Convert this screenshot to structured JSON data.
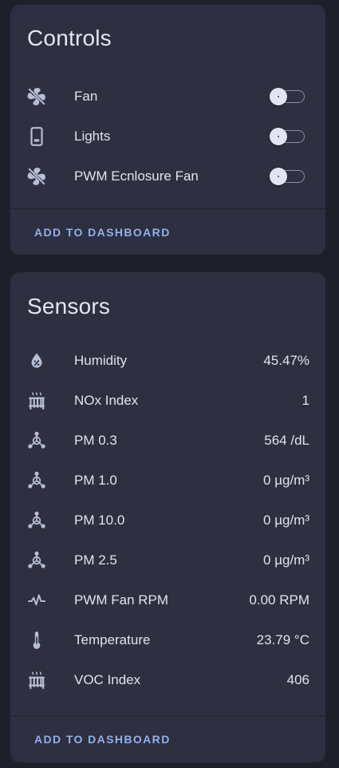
{
  "controls": {
    "title": "Controls",
    "items": [
      {
        "icon": "fan-off-icon",
        "label": "Fan",
        "state": "off"
      },
      {
        "icon": "phone-lights-icon",
        "label": "Lights",
        "state": "off"
      },
      {
        "icon": "fan-off-icon",
        "label": "PWM Ecnlosure Fan",
        "state": "off"
      }
    ],
    "action_label": "ADD TO DASHBOARD"
  },
  "sensors": {
    "title": "Sensors",
    "items": [
      {
        "icon": "water-percent-icon",
        "label": "Humidity",
        "value": "45.47%"
      },
      {
        "icon": "radiator-icon",
        "label": "NOx Index",
        "value": "1"
      },
      {
        "icon": "molecule-icon",
        "label": "PM 0.3",
        "value": "564 /dL"
      },
      {
        "icon": "molecule-icon",
        "label": "PM 1.0",
        "value": "0 µg/m³"
      },
      {
        "icon": "molecule-icon",
        "label": "PM 10.0",
        "value": "0 µg/m³"
      },
      {
        "icon": "molecule-icon",
        "label": "PM 2.5",
        "value": "0 µg/m³"
      },
      {
        "icon": "pulse-icon",
        "label": "PWM Fan RPM",
        "value": "0.00 RPM"
      },
      {
        "icon": "thermometer-icon",
        "label": "Temperature",
        "value": "23.79 °C"
      },
      {
        "icon": "radiator-icon",
        "label": "VOC Index",
        "value": "406"
      }
    ],
    "action_label": "ADD TO DASHBOARD"
  },
  "colors": {
    "background": "#1f1f2c",
    "card": "#2e2f40",
    "icon": "#b7bfd6",
    "accent": "#8fb2ec"
  }
}
